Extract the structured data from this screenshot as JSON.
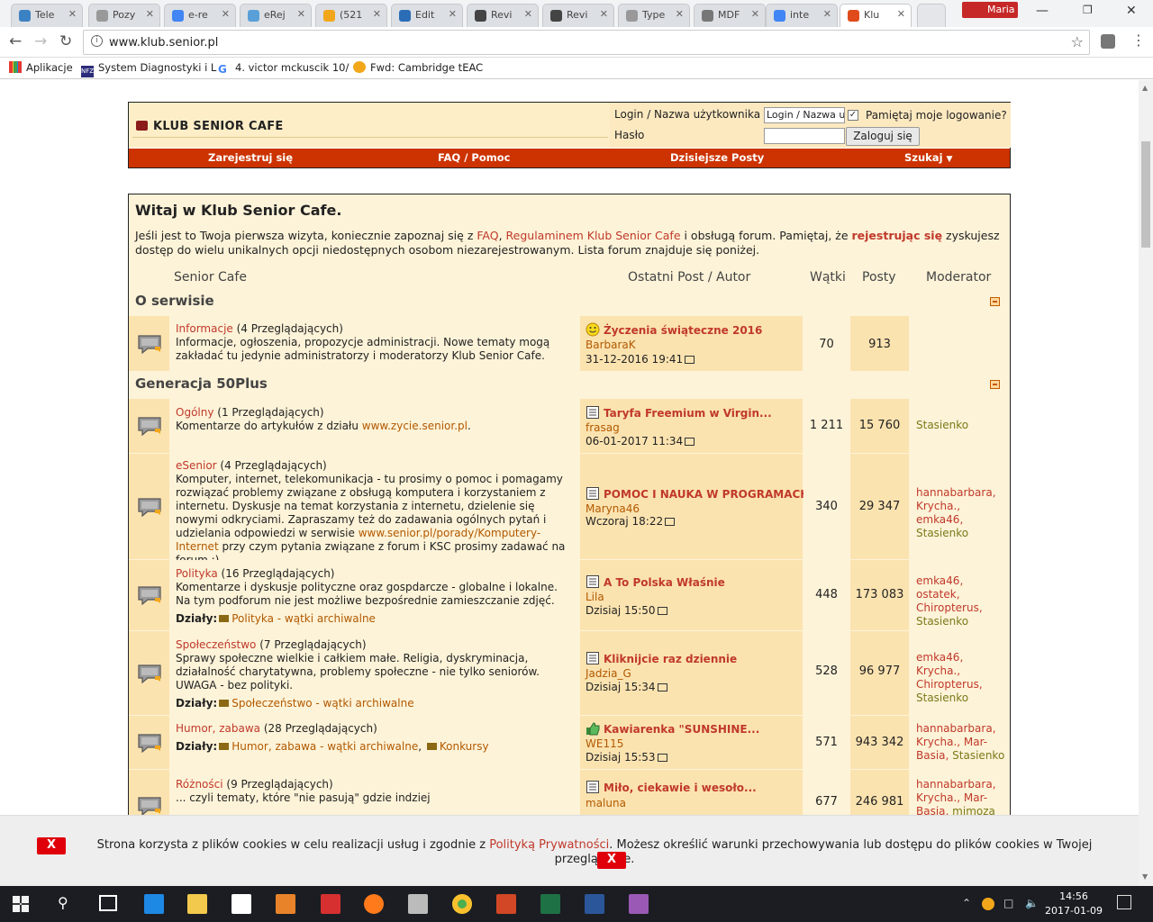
{
  "browser": {
    "tabs": [
      {
        "label": "Tele",
        "color": "#3b82c4"
      },
      {
        "label": "Pozy",
        "color": "#999999"
      },
      {
        "label": "e-re",
        "color": "#4285f4"
      },
      {
        "label": "eRej",
        "color": "#5aa0d8"
      },
      {
        "label": "(521",
        "color": "#f2a71b"
      },
      {
        "label": "Edit",
        "color": "#2a6db6"
      },
      {
        "label": "Revi",
        "color": "#444444"
      },
      {
        "label": "Revi",
        "color": "#444444"
      },
      {
        "label": "Type",
        "color": "#999999"
      },
      {
        "label": "MDF",
        "color": "#777777"
      },
      {
        "label": "inte",
        "color": "#4285f4"
      },
      {
        "label": "Klu",
        "color": "#e04b1b"
      }
    ],
    "profile_name": "Maria",
    "url": "www.klub.senior.pl",
    "bookmarks": [
      {
        "label": "Aplikacje"
      },
      {
        "label": "System Diagnostyki i L"
      },
      {
        "label": "4. victor mckuscik 10/"
      },
      {
        "label": "Fwd: Cambridge tEAC"
      }
    ]
  },
  "header": {
    "brand": "KLUB SENIOR CAFE",
    "login_label": "Login / Nazwa użytkownika",
    "login_value": "Login / Nazwa u",
    "remember_label": "Pamiętaj moje logowanie?",
    "password_label": "Hasło",
    "login_button": "Zaloguj się",
    "menu": [
      "Zarejestruj się",
      "FAQ / Pomoc",
      "Dzisiejsze Posty",
      "Szukaj"
    ]
  },
  "forum": {
    "welcome": "Witaj w Klub Senior Cafe.",
    "intro": {
      "t1": "Jeśli jest to Twoja pierwsza wizyta, koniecznie zapoznaj się z ",
      "faq": "FAQ",
      "t2": ", ",
      "reg": "Regulaminem Klub Senior Cafe",
      "t3": " i obsługą forum. Pamiętaj, że ",
      "register": "rejestrując się",
      "t4": " zyskujesz dostęp do wielu unikalnych opcji niedostępnych osobom niezarejestrowanym. Lista forum znajduje się poniżej."
    },
    "columns": {
      "forum": "Senior Cafe",
      "last_post": "Ostatni Post / Autor",
      "threads": "Wątki",
      "posts": "Posty",
      "moderator": "Moderator"
    },
    "categories": [
      {
        "name": "O serwisie"
      },
      {
        "name": "Generacja 50Plus"
      }
    ],
    "rows": [
      {
        "name": "Informacje",
        "viewers": " (4 Przeglądających)",
        "desc": "Informacje, ogłoszenia, propozycje administracji. Nowe tematy mogą zakładać tu jedynie administratorzy i moderatorzy Klub Senior Cafe.",
        "last_title": "Życzenia świąteczne 2016",
        "last_author": "BarbaraK",
        "last_date": "31-12-2016 19:41",
        "threads": "70",
        "posts": "913"
      },
      {
        "name": "Ogólny",
        "viewers": " (1 Przeglądających)",
        "desc_a": "Komentarze do artykułów z działu ",
        "desc_link": "www.zycie.senior.pl",
        "desc_b": ".",
        "last_title": "Taryfa Freemium w Virgin...",
        "last_author": "frasag",
        "last_date": "06-01-2017 11:34",
        "threads": "1 211",
        "posts": "15 760",
        "mods": [
          "Stasienko"
        ]
      },
      {
        "name": "eSenior",
        "viewers": " (4 Przeglądających)",
        "desc_a": "Komputer, internet, telekomunikacja - tu prosimy o pomoc i pomagamy rozwiązać problemy związane z obsługą komputera i korzystaniem z internetu. Dyskusje na temat korzystania z internetu, dzielenie się nowymi odkryciami. Zapraszamy też do zadawania ogólnych pytań i udzielania odpowiedzi w serwisie ",
        "desc_link": "www.senior.pl/porady/Komputery-Internet",
        "desc_b": " przy czym pytania związane z forum i KSC prosimy zadawać na forum :)",
        "last_title": "POMOC I NAUKA W PROGRAMACH...",
        "last_author": "Maryna46",
        "last_date": "Wczoraj 18:22",
        "threads": "340",
        "posts": "29 347",
        "mods": [
          "hannabarbara",
          "Krycha.",
          "emka46",
          "Stasienko"
        ]
      },
      {
        "name": "Polityka",
        "viewers": " (16 Przeglądających)",
        "desc": "Komentarze i dyskusje polityczne oraz gospdarcze - globalne i lokalne. Na tym podforum nie jest możliwe bezpośrednie zamieszczanie zdjęć.",
        "dzialy_label": "Działy:",
        "subs": [
          "Polityka - wątki archiwalne"
        ],
        "last_title": "A To Polska Właśnie",
        "last_author": "Lila",
        "last_date": "Dzisiaj 15:50",
        "threads": "448",
        "posts": "173 083",
        "mods": [
          "emka46",
          "ostatek",
          "Chiropterus",
          "Stasienko"
        ]
      },
      {
        "name": "Społeczeństwo",
        "viewers": " (7 Przeglądających)",
        "desc": "Sprawy społeczne wielkie i całkiem małe. Religia, dyskryminacja, działalność charytatywna, problemy społeczne - nie tylko seniorów. UWAGA - bez polityki.",
        "dzialy_label": "Działy:",
        "subs": [
          "Społeczeństwo - wątki archiwalne"
        ],
        "last_title": "Kliknijcie raz dziennie",
        "last_author": "Jadzia_G",
        "last_date": "Dzisiaj 15:34",
        "threads": "528",
        "posts": "96 977",
        "mods": [
          "emka46",
          "Krycha.",
          "Chiropterus",
          "Stasienko"
        ]
      },
      {
        "name": "Humor, zabawa",
        "viewers": " (28 Przeglądających)",
        "dzialy_label": "Działy:",
        "subs": [
          "Humor, zabawa - wątki archiwalne",
          "Konkursy"
        ],
        "last_title": "Kawiarenka \"SUNSHINE...",
        "last_author": "WE115",
        "last_date": "Dzisiaj 15:53",
        "threads": "571",
        "posts": "943 342",
        "mods": [
          "hannabarbara",
          "Krycha.",
          "Mar-Basia",
          "Stasienko"
        ]
      },
      {
        "name": "Różności",
        "viewers": " (9 Przeglądających)",
        "desc": "... czyli tematy, które \"nie pasują\" gdzie indziej",
        "last_title": "Miło, ciekawie i wesoło...",
        "last_author": "maluna",
        "last_date": "",
        "threads": "677",
        "posts": "246 981",
        "mods": [
          "hannabarbara",
          "Krycha.",
          "Mar-Basia",
          "mimoza"
        ]
      }
    ]
  },
  "cookie": {
    "close": "X",
    "t1": "Strona korzysta z plików cookies w celu realizacji usług i zgodnie z ",
    "link": "Polityką Prywatności",
    "t2": ". Możesz określić warunki przechowywania lub dostępu do plików cookies w Twojej przeglądarce."
  },
  "taskbar": {
    "time": "14:56",
    "date": "2017-01-09"
  }
}
